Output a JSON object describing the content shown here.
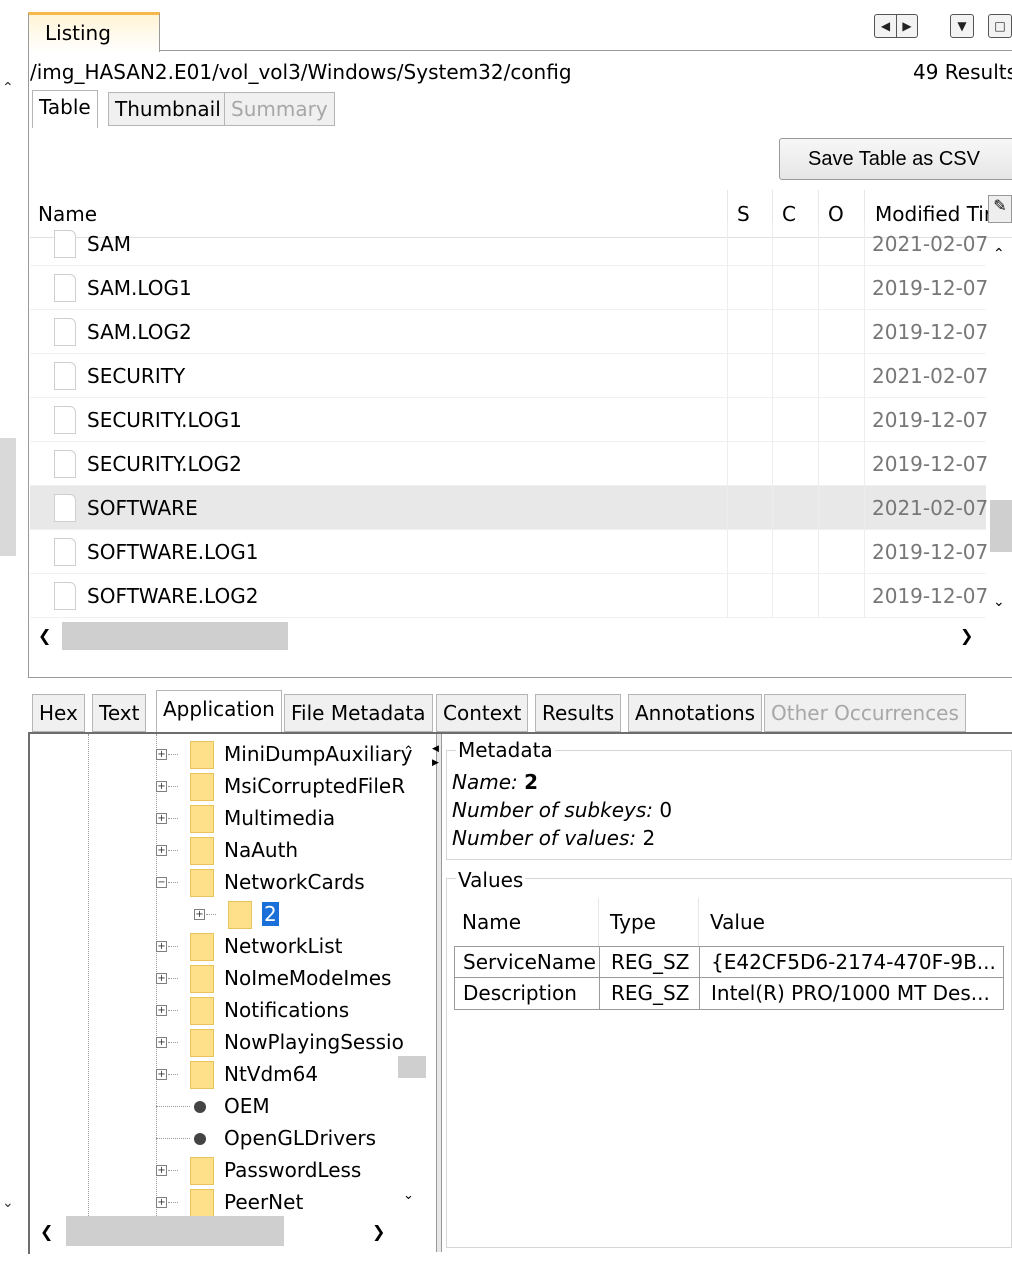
{
  "listing": {
    "tab_label": "Listing",
    "path": "/img_HASAN2.E01/vol_vol3/Windows/System32/config",
    "results": "49  Results",
    "view_tabs": [
      "Table",
      "Thumbnail",
      "Summary"
    ],
    "save_csv_label": "Save Table as CSV",
    "columns": {
      "name": "Name",
      "s": "S",
      "c": "C",
      "o": "O",
      "modified": "Modified Tir"
    },
    "rows": [
      {
        "name": "SAM",
        "modified": "2021-02-07"
      },
      {
        "name": "SAM.LOG1",
        "modified": "2019-12-07"
      },
      {
        "name": "SAM.LOG2",
        "modified": "2019-12-07"
      },
      {
        "name": "SECURITY",
        "modified": "2021-02-07"
      },
      {
        "name": "SECURITY.LOG1",
        "modified": "2019-12-07"
      },
      {
        "name": "SECURITY.LOG2",
        "modified": "2019-12-07"
      },
      {
        "name": "SOFTWARE",
        "modified": "2021-02-07",
        "selected": true
      },
      {
        "name": "SOFTWARE.LOG1",
        "modified": "2019-12-07"
      },
      {
        "name": "SOFTWARE.LOG2",
        "modified": "2019-12-07"
      }
    ]
  },
  "viewer": {
    "tabs": [
      "Hex",
      "Text",
      "Application",
      "File Metadata",
      "Context",
      "Results",
      "Annotations",
      "Other Occurrences"
    ],
    "active_tab": "Application",
    "tree": [
      {
        "label": "MiniDumpAuxiliary",
        "kind": "folder"
      },
      {
        "label": "MsiCorruptedFileR",
        "kind": "folder"
      },
      {
        "label": "Multimedia",
        "kind": "folder"
      },
      {
        "label": "NaAuth",
        "kind": "folder"
      },
      {
        "label": "NetworkCards",
        "kind": "folder",
        "expanded": true
      },
      {
        "label": "2",
        "kind": "folder",
        "child": true,
        "selected": true
      },
      {
        "label": "NetworkList",
        "kind": "folder"
      },
      {
        "label": "NoImeModeImes",
        "kind": "folder"
      },
      {
        "label": "Notifications",
        "kind": "folder"
      },
      {
        "label": "NowPlayingSessio",
        "kind": "folder"
      },
      {
        "label": "NtVdm64",
        "kind": "folder"
      },
      {
        "label": "OEM",
        "kind": "value"
      },
      {
        "label": "OpenGLDrivers",
        "kind": "value"
      },
      {
        "label": "PasswordLess",
        "kind": "folder"
      },
      {
        "label": "PeerNet",
        "kind": "folder"
      }
    ],
    "metadata": {
      "legend": "Metadata",
      "name_label": "Name:",
      "name_value": "2",
      "subkeys_label": "Number of subkeys:",
      "subkeys_value": "0",
      "values_label": "Number of values:",
      "values_value": "2"
    },
    "values": {
      "legend": "Values",
      "columns": [
        "Name",
        "Type",
        "Value"
      ],
      "rows": [
        {
          "name": "ServiceName",
          "type": "REG_SZ",
          "value": "{E42CF5D6-2174-470F-9B..."
        },
        {
          "name": "Description",
          "type": "REG_SZ",
          "value": "Intel(R) PRO/1000 MT Des..."
        }
      ]
    }
  },
  "colors": {
    "selection": "#1a6fd8",
    "tab_accent": "#f5b94a",
    "folder": "#ffe08a"
  },
  "icons": [
    "chevron-up-icon",
    "chevron-down-icon",
    "nav-back-icon",
    "nav-forward-icon",
    "dropdown-icon",
    "maximize-icon",
    "column-settings-icon",
    "file-icon",
    "folder-icon",
    "registry-value-icon",
    "expand-icon",
    "collapse-icon"
  ]
}
